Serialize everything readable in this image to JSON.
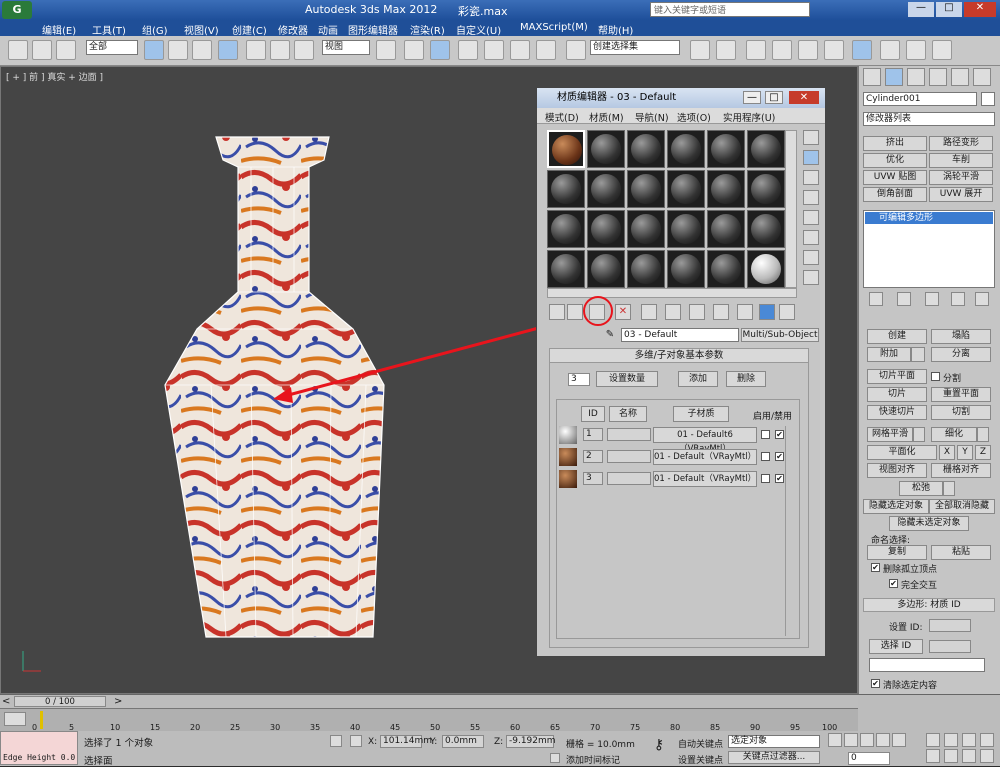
{
  "titlebar": {
    "title": "Autodesk 3ds Max  2012",
    "file": "彩瓷.max",
    "search_placeholder": "键入关键字或短语"
  },
  "menubar": {
    "items": [
      "编辑(E)",
      "工具(T)",
      "组(G)",
      "视图(V)",
      "创建(C)",
      "修改器",
      "动画",
      "图形编辑器",
      "渲染(R)",
      "自定义(U)",
      "MAXScript(M)",
      "帮助(H)"
    ]
  },
  "toolbar": {
    "filter": "全部",
    "view": "视图",
    "selset": "创建选择集"
  },
  "viewport": {
    "label": "[ + ] 前 ] 真实 + 边面 ]"
  },
  "material_editor": {
    "title": "材质编辑器 - 03 - Default",
    "menus": [
      "模式(D)",
      "材质(M)",
      "导航(N)",
      "选项(O)",
      "实用程序(U)"
    ],
    "material_name": "03 - Default",
    "material_type": "Multi/Sub-Object",
    "rollout": "多维/子对象基本参数",
    "count": "3",
    "set_count": "设置数量",
    "add": "添加",
    "delete": "删除",
    "headers": {
      "id": "ID",
      "name": "名称",
      "sub": "子材质",
      "enable": "启用/禁用"
    },
    "rows": [
      {
        "id": "1",
        "sub": "01 - Default6（VRayMtl）"
      },
      {
        "id": "2",
        "sub": "01 - Default（VRayMtl）"
      },
      {
        "id": "3",
        "sub": "01 - Default（VRayMtl）"
      }
    ]
  },
  "panel": {
    "object": "Cylinder001",
    "modlist": "修改器列表",
    "mods": [
      "挤出",
      "路径变形",
      "优化",
      "车削",
      "UVW 贴图",
      "涡轮平滑",
      "倒角剖面",
      "UVW 展开"
    ],
    "stack_item": "可编辑多边形",
    "btns": {
      "create": "创建",
      "collapse": "塌陷",
      "attach": "附加",
      "detach": "分离",
      "slice_plane": "切片平面",
      "split": "分割",
      "slice": "切片",
      "reset_plane": "重置平面",
      "quickslice": "快速切片",
      "cut": "切割",
      "msmooth": "网格平滑",
      "tessellate": "细化",
      "planar": "平面化",
      "x": "X",
      "y": "Y",
      "z": "Z",
      "view_align": "视图对齐",
      "grid_align": "栅格对齐",
      "relax": "松弛",
      "hide_sel": "隐藏选定对象",
      "unhide_all": "全部取消隐藏",
      "hide_unsel": "隐藏未选定对象",
      "named_sel": "命名选择:",
      "copy": "复制",
      "paste": "粘贴",
      "del_iso": "删除孤立顶点",
      "full_interact": "完全交互",
      "matid": "多边形: 材质 ID",
      "set_id": "设置 ID:",
      "select_id": "选择 ID",
      "clear_sel": "清除选定内容"
    }
  },
  "bottom": {
    "frames": "0 / 100",
    "ticks": [
      "0",
      "5",
      "10",
      "15",
      "20",
      "25",
      "30",
      "35",
      "40",
      "45",
      "50",
      "55",
      "60",
      "65",
      "70",
      "75",
      "80",
      "85",
      "90",
      "95",
      "100"
    ],
    "status1": "选择了 1 个对象",
    "status2": "选择面",
    "x": "101.14mm",
    "y": "0.0mm",
    "z": "-9.192mm",
    "grid": "栅格 = 10.0mm",
    "autokey": "自动关键点",
    "selected": "选定对象",
    "setkey": "设置关键点",
    "keyfilter": "关键点过滤器...",
    "addtime": "添加时间标记",
    "maxscript": "Edge Height 0.0",
    "frame": "0"
  }
}
